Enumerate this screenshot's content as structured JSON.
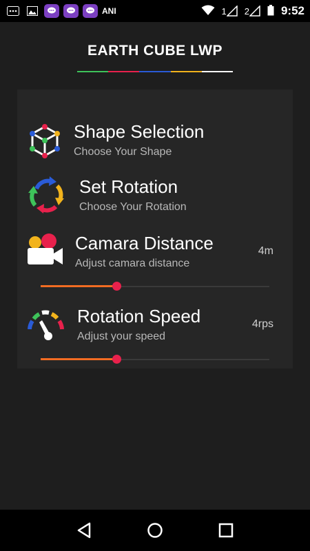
{
  "status_bar": {
    "left_label": "ANI",
    "sim1": "1",
    "sim2": "2",
    "time": "9:52"
  },
  "app": {
    "title": "EARTH CUBE LWP",
    "title_underline_colors": [
      "#3ec35a",
      "#e8214c",
      "#2a5bd7",
      "#f2b31c",
      "#ffffff"
    ]
  },
  "settings": [
    {
      "title": "Shape Selection",
      "subtitle": "Choose Your Shape",
      "icon": "cube-icon"
    },
    {
      "title": "Set Rotation",
      "subtitle": "Choose Your Rotation",
      "icon": "rotation-arrows-icon"
    },
    {
      "title": "Camara Distance",
      "subtitle": "Adjust camara distance",
      "value": "4m",
      "icon": "camera-icon",
      "slider_fraction": 0.33
    },
    {
      "title": "Rotation Speed",
      "subtitle": "Adjust your speed",
      "value": "4rps",
      "icon": "speedometer-icon",
      "slider_fraction": 0.33
    }
  ],
  "colors": {
    "slider_fill": "#f26c22",
    "slider_thumb": "#e8214c"
  }
}
